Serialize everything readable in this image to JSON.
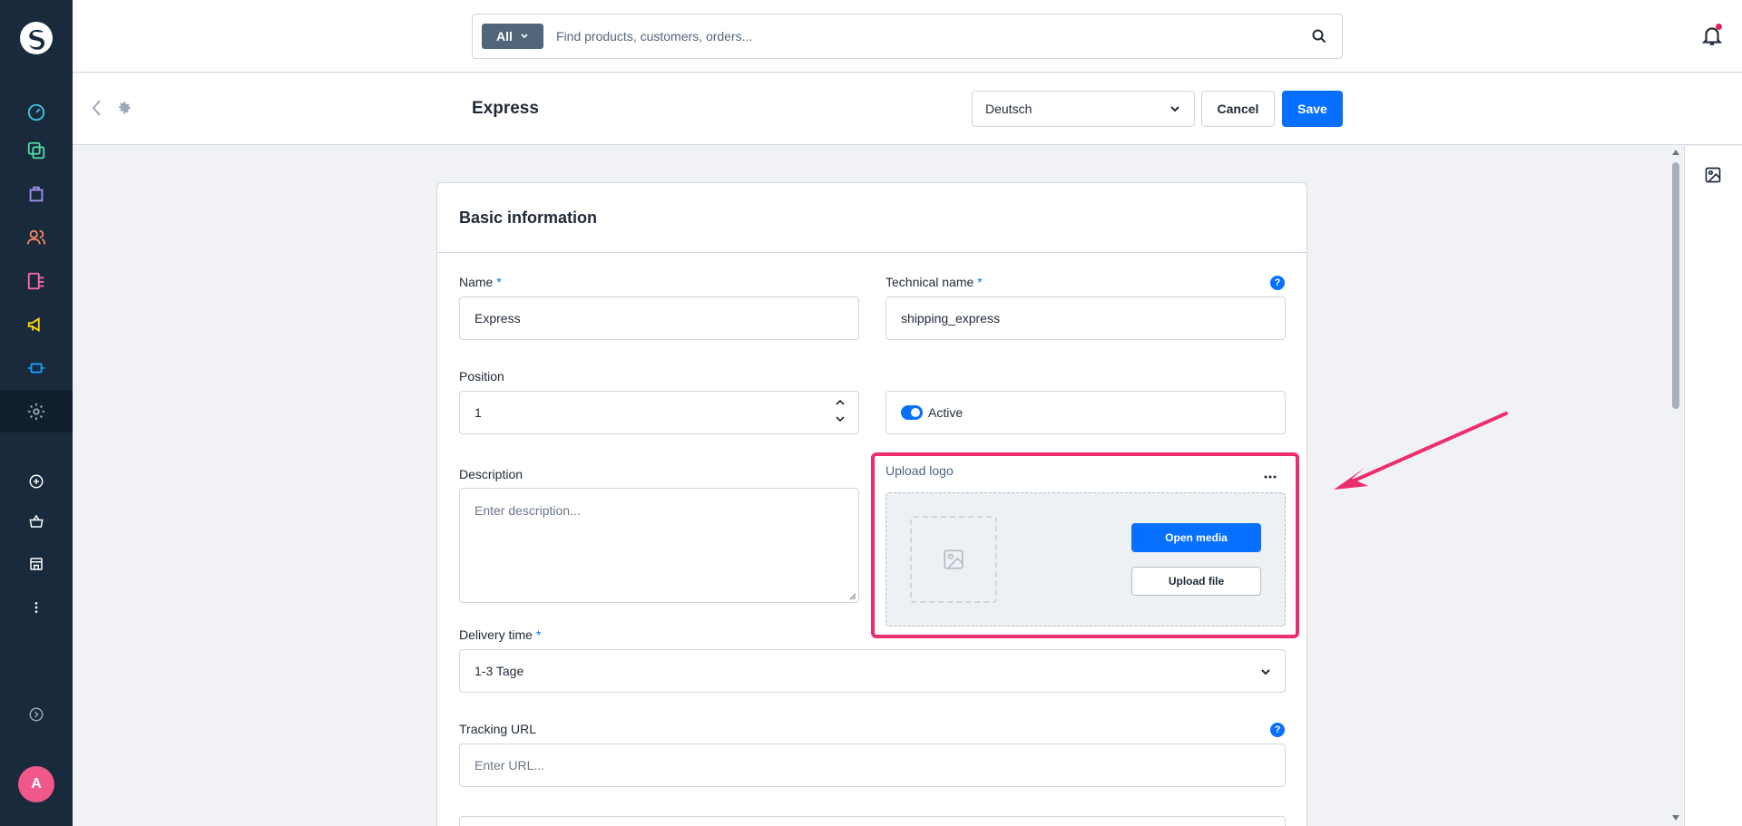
{
  "header": {
    "search_type": "All",
    "search_placeholder": "Find products, customers, orders..."
  },
  "smartbar": {
    "title": "Express",
    "language": "Deutsch",
    "cancel_label": "Cancel",
    "save_label": "Save"
  },
  "sidebar": {
    "avatar_initial": "A",
    "items": [
      {
        "icon": "dashboard-icon",
        "color": "#3fc6e0"
      },
      {
        "icon": "catalog-icon",
        "color": "#57d9a3"
      },
      {
        "icon": "orders-icon",
        "color": "#a092f0"
      },
      {
        "icon": "customers-icon",
        "color": "#f88962"
      },
      {
        "icon": "content-icon",
        "color": "#ff68b4"
      },
      {
        "icon": "marketing-icon",
        "color": "#ffd700"
      },
      {
        "icon": "extensions-icon",
        "color": "#189eff"
      },
      {
        "icon": "settings-icon",
        "color": "#9aa8b5"
      },
      {
        "icon": "add-sales-channel-icon",
        "color": "#ffffff"
      },
      {
        "icon": "storefront-icon",
        "color": "#ffffff"
      },
      {
        "icon": "shop-icon",
        "color": "#ffffff"
      },
      {
        "icon": "more-icon",
        "color": "#ffffff"
      },
      {
        "icon": "expand-icon",
        "color": "#9aa8b5"
      }
    ]
  },
  "card": {
    "title": "Basic information",
    "name_label": "Name",
    "name_value": "Express",
    "technical_name_label": "Technical name",
    "technical_name_value": "shipping_express",
    "position_label": "Position",
    "position_value": "1",
    "active_label": "Active",
    "active": true,
    "description_label": "Description",
    "description_placeholder": "Enter description...",
    "upload_label": "Upload logo",
    "open_media_label": "Open media",
    "upload_file_label": "Upload file",
    "delivery_time_label": "Delivery time",
    "delivery_time_value": "1-3 Tage",
    "tracking_url_label": "Tracking URL",
    "tracking_url_placeholder": "Enter URL...",
    "required_marker": "*",
    "help_glyph": "?"
  },
  "colors": {
    "accent": "#0870ff",
    "highlight": "#ee2d6d",
    "sidebar_bg": "#182a3c"
  }
}
